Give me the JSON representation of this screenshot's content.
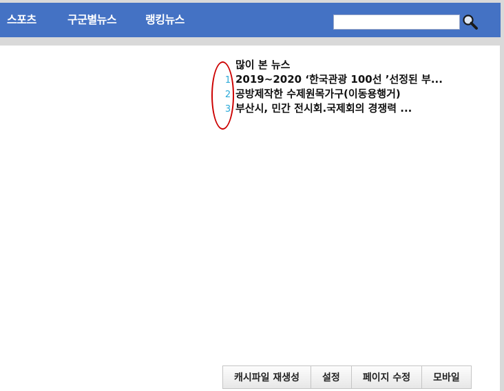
{
  "nav": {
    "items": [
      {
        "label": "스포츠"
      },
      {
        "label": "구군별뉴스"
      },
      {
        "label": "랭킹뉴스"
      }
    ],
    "search": {
      "value": "",
      "icon": "search-icon"
    }
  },
  "popular_news": {
    "title": "많이 본 뉴스",
    "items": [
      {
        "rank": "1",
        "title": "2019~2020 ‘한국관광 100선 ’선정된 부..."
      },
      {
        "rank": "2",
        "title": "공방제작한 수제원목가구(이동용행거)"
      },
      {
        "rank": "3",
        "title": "부산시, 민간 전시회.국제회의 경쟁력 ..."
      }
    ]
  },
  "footer": {
    "buttons": [
      {
        "label": "캐시파일 재생성"
      },
      {
        "label": "설정"
      },
      {
        "label": "페이지 수정"
      },
      {
        "label": "모바일"
      }
    ]
  },
  "colors": {
    "nav_bg": "#4472c4",
    "rank_number": "#2aa9d8",
    "annotation_circle": "#cc0000"
  }
}
